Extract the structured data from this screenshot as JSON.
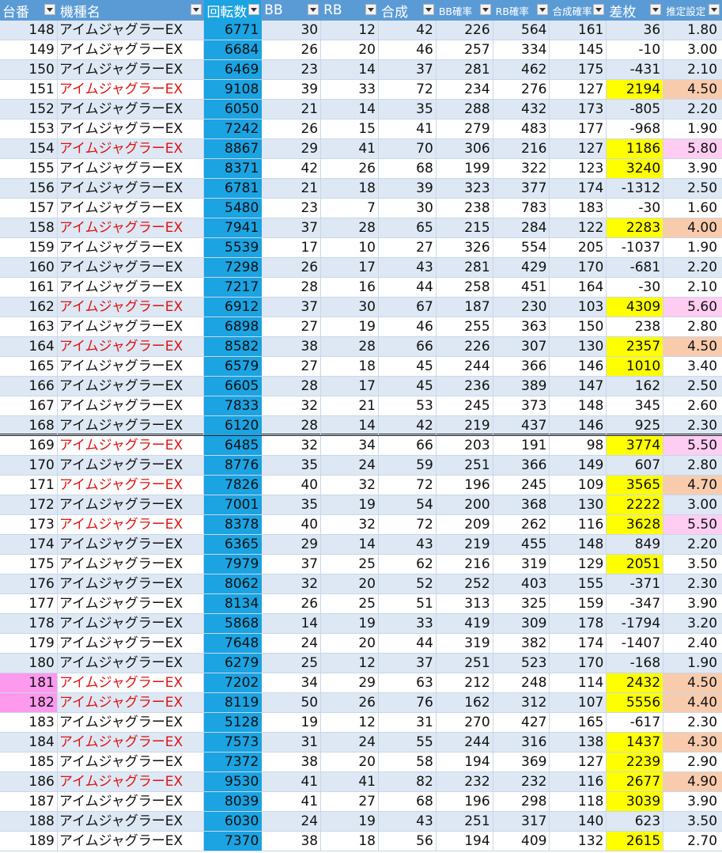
{
  "header": {
    "cols": [
      "台番",
      "機種名",
      "回転数",
      "BB",
      "RB",
      "合成",
      "BB確率",
      "RB確率",
      "合成確率",
      "差枚",
      "推定設定"
    ]
  },
  "rows": [
    {
      "no": "148",
      "name": "アイムジャグラーEX",
      "spin": "6771",
      "bb": "30",
      "rb": "12",
      "total": "42",
      "bbr": "226",
      "rbr": "564",
      "totr": "161",
      "diff": "36",
      "set": "1.80",
      "red": false,
      "diff_hl": "",
      "set_hl": "",
      "no_hl": ""
    },
    {
      "no": "149",
      "name": "アイムジャグラーEX",
      "spin": "6684",
      "bb": "26",
      "rb": "20",
      "total": "46",
      "bbr": "257",
      "rbr": "334",
      "totr": "145",
      "diff": "-10",
      "set": "3.00",
      "red": false,
      "diff_hl": "",
      "set_hl": "",
      "no_hl": ""
    },
    {
      "no": "150",
      "name": "アイムジャグラーEX",
      "spin": "6469",
      "bb": "23",
      "rb": "14",
      "total": "37",
      "bbr": "281",
      "rbr": "462",
      "totr": "175",
      "diff": "-431",
      "set": "2.10",
      "red": false,
      "diff_hl": "",
      "set_hl": "",
      "no_hl": ""
    },
    {
      "no": "151",
      "name": "アイムジャグラーEX",
      "spin": "9108",
      "bb": "39",
      "rb": "33",
      "total": "72",
      "bbr": "234",
      "rbr": "276",
      "totr": "127",
      "diff": "2194",
      "set": "4.50",
      "red": true,
      "diff_hl": "yellow",
      "set_hl": "orange",
      "no_hl": ""
    },
    {
      "no": "152",
      "name": "アイムジャグラーEX",
      "spin": "6050",
      "bb": "21",
      "rb": "14",
      "total": "35",
      "bbr": "288",
      "rbr": "432",
      "totr": "173",
      "diff": "-805",
      "set": "2.20",
      "red": false,
      "diff_hl": "",
      "set_hl": "",
      "no_hl": ""
    },
    {
      "no": "153",
      "name": "アイムジャグラーEX",
      "spin": "7242",
      "bb": "26",
      "rb": "15",
      "total": "41",
      "bbr": "279",
      "rbr": "483",
      "totr": "177",
      "diff": "-968",
      "set": "1.90",
      "red": false,
      "diff_hl": "",
      "set_hl": "",
      "no_hl": ""
    },
    {
      "no": "154",
      "name": "アイムジャグラーEX",
      "spin": "8867",
      "bb": "29",
      "rb": "41",
      "total": "70",
      "bbr": "306",
      "rbr": "216",
      "totr": "127",
      "diff": "1186",
      "set": "5.80",
      "red": true,
      "diff_hl": "yellow",
      "set_hl": "pink",
      "no_hl": ""
    },
    {
      "no": "155",
      "name": "アイムジャグラーEX",
      "spin": "8371",
      "bb": "42",
      "rb": "26",
      "total": "68",
      "bbr": "199",
      "rbr": "322",
      "totr": "123",
      "diff": "3240",
      "set": "3.90",
      "red": false,
      "diff_hl": "yellow",
      "set_hl": "",
      "no_hl": ""
    },
    {
      "no": "156",
      "name": "アイムジャグラーEX",
      "spin": "6781",
      "bb": "21",
      "rb": "18",
      "total": "39",
      "bbr": "323",
      "rbr": "377",
      "totr": "174",
      "diff": "-1312",
      "set": "2.50",
      "red": false,
      "diff_hl": "",
      "set_hl": "",
      "no_hl": ""
    },
    {
      "no": "157",
      "name": "アイムジャグラーEX",
      "spin": "5480",
      "bb": "23",
      "rb": "7",
      "total": "30",
      "bbr": "238",
      "rbr": "783",
      "totr": "183",
      "diff": "-30",
      "set": "1.60",
      "red": false,
      "diff_hl": "",
      "set_hl": "",
      "no_hl": ""
    },
    {
      "no": "158",
      "name": "アイムジャグラーEX",
      "spin": "7941",
      "bb": "37",
      "rb": "28",
      "total": "65",
      "bbr": "215",
      "rbr": "284",
      "totr": "122",
      "diff": "2283",
      "set": "4.00",
      "red": true,
      "diff_hl": "yellow",
      "set_hl": "orange",
      "no_hl": ""
    },
    {
      "no": "159",
      "name": "アイムジャグラーEX",
      "spin": "5539",
      "bb": "17",
      "rb": "10",
      "total": "27",
      "bbr": "326",
      "rbr": "554",
      "totr": "205",
      "diff": "-1037",
      "set": "1.90",
      "red": false,
      "diff_hl": "",
      "set_hl": "",
      "no_hl": ""
    },
    {
      "no": "160",
      "name": "アイムジャグラーEX",
      "spin": "7298",
      "bb": "26",
      "rb": "17",
      "total": "43",
      "bbr": "281",
      "rbr": "429",
      "totr": "170",
      "diff": "-681",
      "set": "2.20",
      "red": false,
      "diff_hl": "",
      "set_hl": "",
      "no_hl": ""
    },
    {
      "no": "161",
      "name": "アイムジャグラーEX",
      "spin": "7217",
      "bb": "28",
      "rb": "16",
      "total": "44",
      "bbr": "258",
      "rbr": "451",
      "totr": "164",
      "diff": "-30",
      "set": "2.10",
      "red": false,
      "diff_hl": "",
      "set_hl": "",
      "no_hl": ""
    },
    {
      "no": "162",
      "name": "アイムジャグラーEX",
      "spin": "6912",
      "bb": "37",
      "rb": "30",
      "total": "67",
      "bbr": "187",
      "rbr": "230",
      "totr": "103",
      "diff": "4309",
      "set": "5.60",
      "red": true,
      "diff_hl": "yellow",
      "set_hl": "pink",
      "no_hl": ""
    },
    {
      "no": "163",
      "name": "アイムジャグラーEX",
      "spin": "6898",
      "bb": "27",
      "rb": "19",
      "total": "46",
      "bbr": "255",
      "rbr": "363",
      "totr": "150",
      "diff": "238",
      "set": "2.80",
      "red": false,
      "diff_hl": "",
      "set_hl": "",
      "no_hl": ""
    },
    {
      "no": "164",
      "name": "アイムジャグラーEX",
      "spin": "8582",
      "bb": "38",
      "rb": "28",
      "total": "66",
      "bbr": "226",
      "rbr": "307",
      "totr": "130",
      "diff": "2357",
      "set": "4.50",
      "red": true,
      "diff_hl": "yellow",
      "set_hl": "orange",
      "no_hl": ""
    },
    {
      "no": "165",
      "name": "アイムジャグラーEX",
      "spin": "6579",
      "bb": "27",
      "rb": "18",
      "total": "45",
      "bbr": "244",
      "rbr": "366",
      "totr": "146",
      "diff": "1010",
      "set": "3.40",
      "red": false,
      "diff_hl": "yellow",
      "set_hl": "",
      "no_hl": ""
    },
    {
      "no": "166",
      "name": "アイムジャグラーEX",
      "spin": "6605",
      "bb": "28",
      "rb": "17",
      "total": "45",
      "bbr": "236",
      "rbr": "389",
      "totr": "147",
      "diff": "162",
      "set": "2.50",
      "red": false,
      "diff_hl": "",
      "set_hl": "",
      "no_hl": ""
    },
    {
      "no": "167",
      "name": "アイムジャグラーEX",
      "spin": "7833",
      "bb": "32",
      "rb": "21",
      "total": "53",
      "bbr": "245",
      "rbr": "373",
      "totr": "148",
      "diff": "345",
      "set": "2.60",
      "red": false,
      "diff_hl": "",
      "set_hl": "",
      "no_hl": ""
    },
    {
      "no": "168",
      "name": "アイムジャグラーEX",
      "spin": "6120",
      "bb": "28",
      "rb": "14",
      "total": "42",
      "bbr": "219",
      "rbr": "437",
      "totr": "146",
      "diff": "925",
      "set": "2.30",
      "red": false,
      "diff_hl": "",
      "set_hl": "",
      "no_hl": ""
    },
    {
      "no": "169",
      "name": "アイムジャグラーEX",
      "spin": "6485",
      "bb": "32",
      "rb": "34",
      "total": "66",
      "bbr": "203",
      "rbr": "191",
      "totr": "98",
      "diff": "3774",
      "set": "5.50",
      "red": true,
      "diff_hl": "yellow",
      "set_hl": "pink",
      "no_hl": ""
    },
    {
      "no": "170",
      "name": "アイムジャグラーEX",
      "spin": "8776",
      "bb": "35",
      "rb": "24",
      "total": "59",
      "bbr": "251",
      "rbr": "366",
      "totr": "149",
      "diff": "607",
      "set": "2.80",
      "red": false,
      "diff_hl": "",
      "set_hl": "",
      "no_hl": ""
    },
    {
      "no": "171",
      "name": "アイムジャグラーEX",
      "spin": "7826",
      "bb": "40",
      "rb": "32",
      "total": "72",
      "bbr": "196",
      "rbr": "245",
      "totr": "109",
      "diff": "3565",
      "set": "4.70",
      "red": true,
      "diff_hl": "yellow",
      "set_hl": "orange",
      "no_hl": ""
    },
    {
      "no": "172",
      "name": "アイムジャグラーEX",
      "spin": "7001",
      "bb": "35",
      "rb": "19",
      "total": "54",
      "bbr": "200",
      "rbr": "368",
      "totr": "130",
      "diff": "2222",
      "set": "3.00",
      "red": false,
      "diff_hl": "yellow",
      "set_hl": "",
      "no_hl": ""
    },
    {
      "no": "173",
      "name": "アイムジャグラーEX",
      "spin": "8378",
      "bb": "40",
      "rb": "32",
      "total": "72",
      "bbr": "209",
      "rbr": "262",
      "totr": "116",
      "diff": "3628",
      "set": "5.50",
      "red": true,
      "diff_hl": "yellow",
      "set_hl": "pink",
      "no_hl": ""
    },
    {
      "no": "174",
      "name": "アイムジャグラーEX",
      "spin": "6365",
      "bb": "29",
      "rb": "14",
      "total": "43",
      "bbr": "219",
      "rbr": "455",
      "totr": "148",
      "diff": "849",
      "set": "2.20",
      "red": false,
      "diff_hl": "",
      "set_hl": "",
      "no_hl": ""
    },
    {
      "no": "175",
      "name": "アイムジャグラーEX",
      "spin": "7979",
      "bb": "37",
      "rb": "25",
      "total": "62",
      "bbr": "216",
      "rbr": "319",
      "totr": "129",
      "diff": "2051",
      "set": "3.50",
      "red": false,
      "diff_hl": "yellow",
      "set_hl": "",
      "no_hl": ""
    },
    {
      "no": "176",
      "name": "アイムジャグラーEX",
      "spin": "8062",
      "bb": "32",
      "rb": "20",
      "total": "52",
      "bbr": "252",
      "rbr": "403",
      "totr": "155",
      "diff": "-371",
      "set": "2.30",
      "red": false,
      "diff_hl": "",
      "set_hl": "",
      "no_hl": ""
    },
    {
      "no": "177",
      "name": "アイムジャグラーEX",
      "spin": "8134",
      "bb": "26",
      "rb": "25",
      "total": "51",
      "bbr": "313",
      "rbr": "325",
      "totr": "159",
      "diff": "-347",
      "set": "3.90",
      "red": false,
      "diff_hl": "",
      "set_hl": "",
      "no_hl": ""
    },
    {
      "no": "178",
      "name": "アイムジャグラーEX",
      "spin": "5868",
      "bb": "14",
      "rb": "19",
      "total": "33",
      "bbr": "419",
      "rbr": "309",
      "totr": "178",
      "diff": "-1794",
      "set": "3.20",
      "red": false,
      "diff_hl": "",
      "set_hl": "",
      "no_hl": ""
    },
    {
      "no": "179",
      "name": "アイムジャグラーEX",
      "spin": "7648",
      "bb": "24",
      "rb": "20",
      "total": "44",
      "bbr": "319",
      "rbr": "382",
      "totr": "174",
      "diff": "-1407",
      "set": "2.40",
      "red": false,
      "diff_hl": "",
      "set_hl": "",
      "no_hl": ""
    },
    {
      "no": "180",
      "name": "アイムジャグラーEX",
      "spin": "6279",
      "bb": "25",
      "rb": "12",
      "total": "37",
      "bbr": "251",
      "rbr": "523",
      "totr": "170",
      "diff": "-168",
      "set": "1.90",
      "red": false,
      "diff_hl": "",
      "set_hl": "",
      "no_hl": ""
    },
    {
      "no": "181",
      "name": "アイムジャグラーEX",
      "spin": "7202",
      "bb": "34",
      "rb": "29",
      "total": "63",
      "bbr": "212",
      "rbr": "248",
      "totr": "114",
      "diff": "2432",
      "set": "4.50",
      "red": true,
      "diff_hl": "yellow",
      "set_hl": "orange",
      "no_hl": "magenta"
    },
    {
      "no": "182",
      "name": "アイムジャグラーEX",
      "spin": "8119",
      "bb": "50",
      "rb": "26",
      "total": "76",
      "bbr": "162",
      "rbr": "312",
      "totr": "107",
      "diff": "5556",
      "set": "4.40",
      "red": true,
      "diff_hl": "yellow",
      "set_hl": "orange",
      "no_hl": "magenta"
    },
    {
      "no": "183",
      "name": "アイムジャグラーEX",
      "spin": "5128",
      "bb": "19",
      "rb": "12",
      "total": "31",
      "bbr": "270",
      "rbr": "427",
      "totr": "165",
      "diff": "-617",
      "set": "2.30",
      "red": false,
      "diff_hl": "",
      "set_hl": "",
      "no_hl": ""
    },
    {
      "no": "184",
      "name": "アイムジャグラーEX",
      "spin": "7573",
      "bb": "31",
      "rb": "24",
      "total": "55",
      "bbr": "244",
      "rbr": "316",
      "totr": "138",
      "diff": "1437",
      "set": "4.30",
      "red": true,
      "diff_hl": "yellow",
      "set_hl": "orange",
      "no_hl": ""
    },
    {
      "no": "185",
      "name": "アイムジャグラーEX",
      "spin": "7372",
      "bb": "38",
      "rb": "20",
      "total": "58",
      "bbr": "194",
      "rbr": "369",
      "totr": "127",
      "diff": "2239",
      "set": "2.90",
      "red": false,
      "diff_hl": "yellow",
      "set_hl": "",
      "no_hl": ""
    },
    {
      "no": "186",
      "name": "アイムジャグラーEX",
      "spin": "9530",
      "bb": "41",
      "rb": "41",
      "total": "82",
      "bbr": "232",
      "rbr": "232",
      "totr": "116",
      "diff": "2677",
      "set": "4.90",
      "red": true,
      "diff_hl": "yellow",
      "set_hl": "orange",
      "no_hl": ""
    },
    {
      "no": "187",
      "name": "アイムジャグラーEX",
      "spin": "8039",
      "bb": "41",
      "rb": "27",
      "total": "68",
      "bbr": "196",
      "rbr": "298",
      "totr": "118",
      "diff": "3039",
      "set": "3.90",
      "red": false,
      "diff_hl": "yellow",
      "set_hl": "",
      "no_hl": ""
    },
    {
      "no": "188",
      "name": "アイムジャグラーEX",
      "spin": "6030",
      "bb": "24",
      "rb": "19",
      "total": "43",
      "bbr": "251",
      "rbr": "317",
      "totr": "140",
      "diff": "623",
      "set": "3.50",
      "red": false,
      "diff_hl": "",
      "set_hl": "",
      "no_hl": ""
    },
    {
      "no": "189",
      "name": "アイムジャグラーEX",
      "spin": "7370",
      "bb": "38",
      "rb": "18",
      "total": "56",
      "bbr": "194",
      "rbr": "409",
      "totr": "132",
      "diff": "2615",
      "set": "2.70",
      "red": false,
      "diff_hl": "yellow",
      "set_hl": "",
      "no_hl": ""
    }
  ],
  "colors": {
    "header_bg": "#5b9bd5",
    "spin_col_bg": "#1ba3e2",
    "band_bg": "#dde8f4",
    "highlight_name": "#e01010",
    "diff_highlight": "#ffff00",
    "set_orange": "#f8cbad",
    "set_pink": "#ffccf2",
    "no_magenta": "#ff99ee"
  },
  "icons": {
    "filter": "filter-dropdown-icon"
  }
}
